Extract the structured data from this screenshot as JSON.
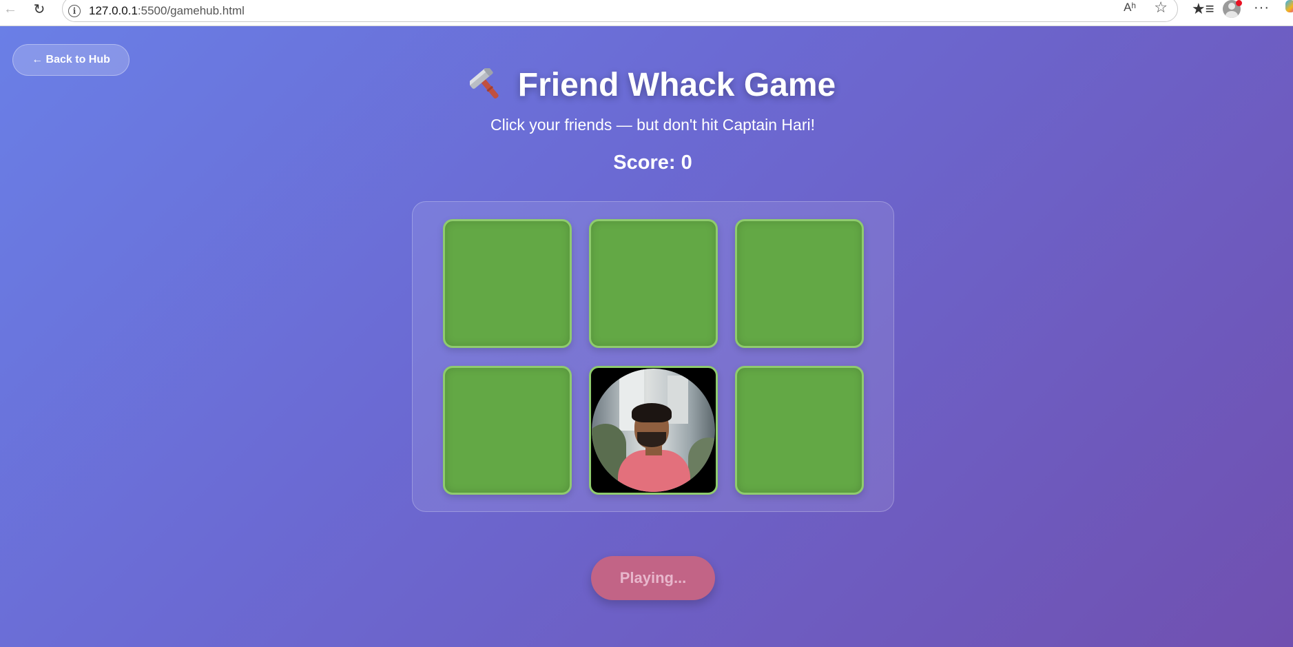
{
  "browser": {
    "url_host": "127.0.0.1",
    "url_rest": ":5500/gamehub.html",
    "info_glyph": "i",
    "read_aloud_glyph": "Aʰ"
  },
  "page": {
    "back_button_label": "← Back to Hub",
    "title": "Friend Whack Game",
    "subtitle": "Click your friends — but don't hit Captain Hari!",
    "score_label": "Score: 0",
    "status_button_label": "Playing..."
  },
  "board": {
    "rows": 2,
    "cols": 3,
    "active_hole_index": 4,
    "active_content": "friend-photo"
  },
  "colors": {
    "hole_green": "#63a845",
    "hole_border": "#8fcb6e",
    "button_pink": "#c26486",
    "background_start": "#6a7fe6",
    "background_end": "#7050b0"
  }
}
